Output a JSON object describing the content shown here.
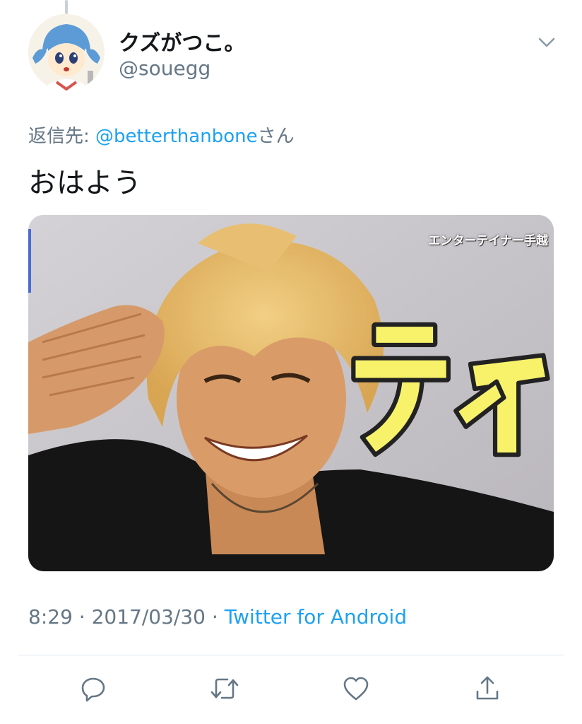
{
  "tweet": {
    "display_name": "クズがつこ。",
    "handle": "@souegg",
    "reply_prefix": "返信先: ",
    "reply_to": "@betterthanbone",
    "reply_suffix": "さん",
    "text": "おはよう",
    "time": "8:29",
    "separator_1": " · ",
    "date": "2017/03/30",
    "separator_2": " · ",
    "source": "Twitter for Android"
  },
  "media": {
    "caption": "エンターテイナー手越",
    "overlay_text": "テイ"
  },
  "icons": {
    "caret": "chevron-down-icon",
    "reply": "reply-icon",
    "retweet": "retweet-icon",
    "like": "heart-icon",
    "share": "share-icon"
  },
  "colors": {
    "link": "#1da1f2",
    "secondary_text": "#657786",
    "primary_text": "#14171a",
    "divider": "#e1e8ed"
  }
}
